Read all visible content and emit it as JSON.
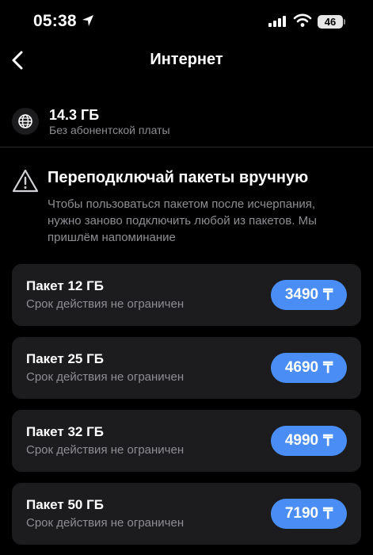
{
  "status_bar": {
    "time": "05:38",
    "battery": "46"
  },
  "nav": {
    "title": "Интернет"
  },
  "plan": {
    "amount": "14.3 ГБ",
    "subtitle": "Без абонентской платы"
  },
  "notice": {
    "title": "Переподключай пакеты вручную",
    "text": "Чтобы пользоваться пакетом после исчерпания, нужно заново подключить любой из пакетов. Мы пришлём напоминание"
  },
  "packages": [
    {
      "title": "Пакет 12 ГБ",
      "subtitle": "Срок действия не ограничен",
      "price": "3490",
      "currency": "₸"
    },
    {
      "title": "Пакет 25 ГБ",
      "subtitle": "Срок действия не ограничен",
      "price": "4690",
      "currency": "₸"
    },
    {
      "title": "Пакет 32 ГБ",
      "subtitle": "Срок действия не ограничен",
      "price": "4990",
      "currency": "₸"
    },
    {
      "title": "Пакет 50 ГБ",
      "subtitle": "Срок действия не ограничен",
      "price": "7190",
      "currency": "₸"
    }
  ],
  "icons": {
    "location": "location-arrow-icon",
    "signal": "cellular-signal-icon",
    "wifi": "wifi-icon",
    "back": "chevron-left-icon",
    "globe": "globe-icon",
    "warning": "warning-triangle-icon"
  },
  "colors": {
    "accent": "#4a8ef5",
    "card": "#1c1c1e",
    "secondary_text": "#8e8e93"
  }
}
